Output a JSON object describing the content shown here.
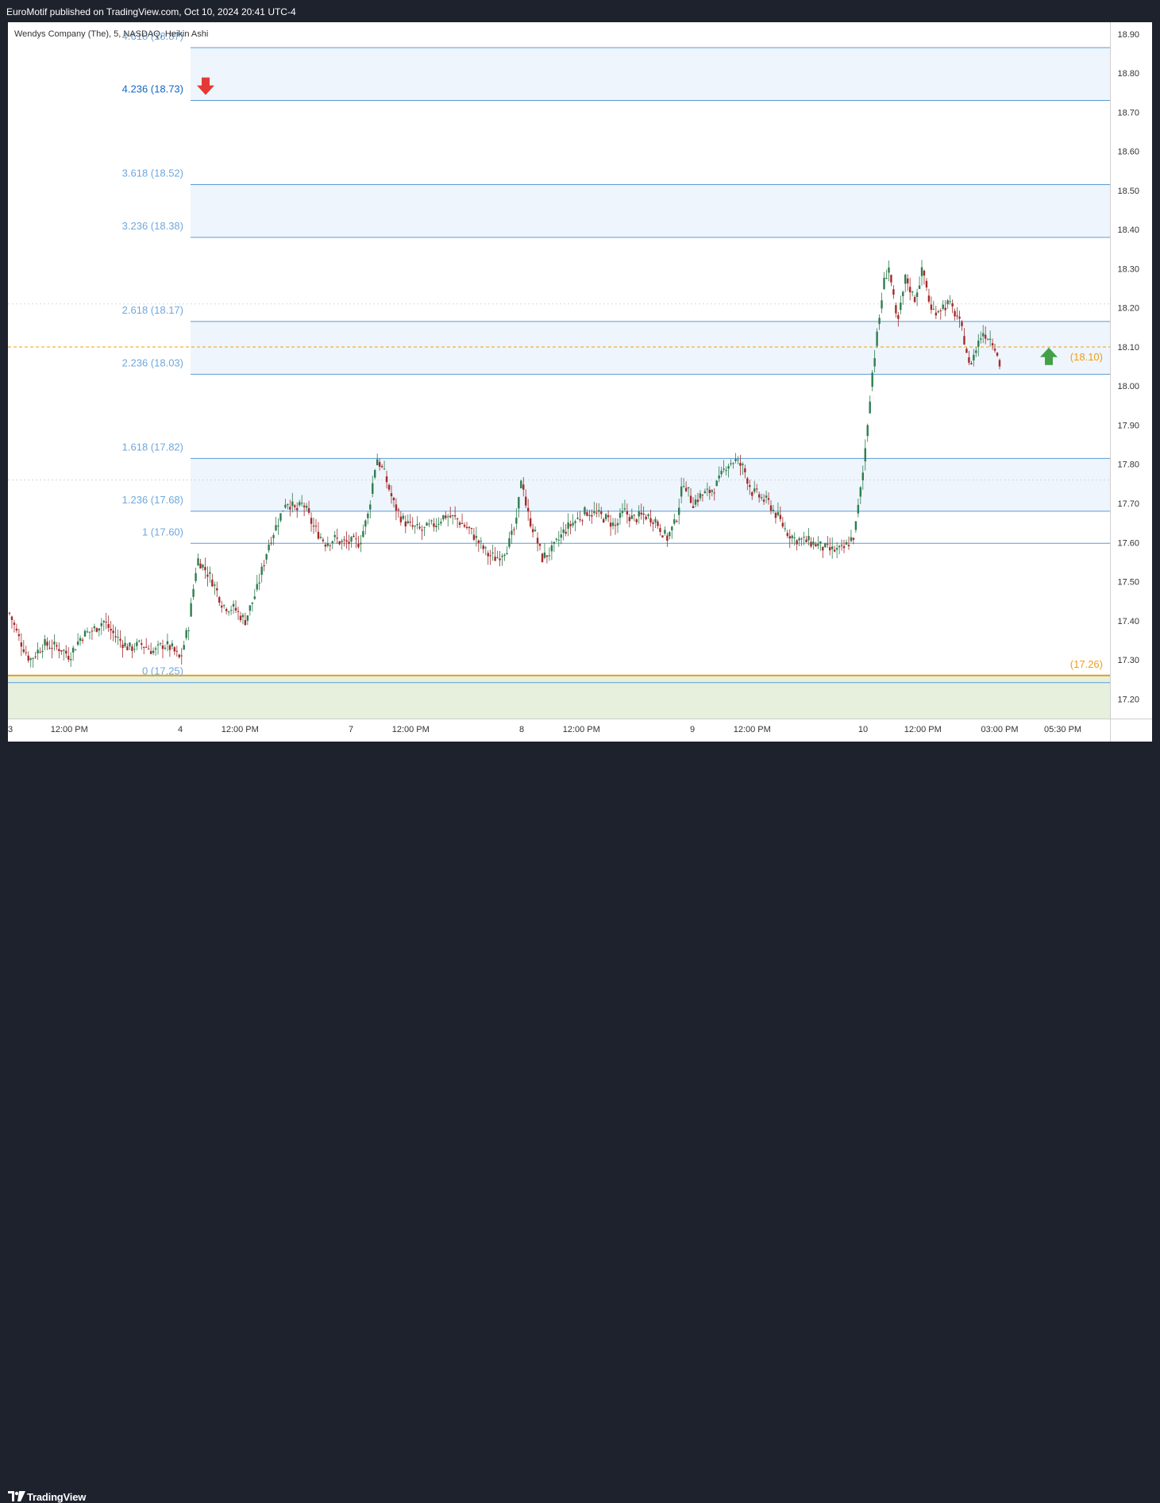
{
  "publisher": "EuroMotif published on TradingView.com, Oct 10, 2024 20:41 UTC-4",
  "symbol_legend": "Wendys Company (The), 5, NASDAQ, Heikin Ashi",
  "brand": "TradingView",
  "colors": {
    "up": "#2e7d4f",
    "down": "#a52a2a",
    "fib_line": "#5b9bd5",
    "fib_label": "#6fa8dc",
    "fib_label_emph": "#1565c0",
    "orange": "#f39c12",
    "zone_blue": "#eef5fc",
    "zone_green": "#e6f0dd",
    "arrow_down": "#e53935",
    "arrow_up": "#43a047"
  },
  "chart_data": {
    "type": "candlestick",
    "style": "Heikin Ashi",
    "interval": "5",
    "exchange": "NASDAQ",
    "y_axis": {
      "min": 17.15,
      "max": 18.93,
      "ticks": [
        "18.90",
        "18.80",
        "18.70",
        "18.60",
        "18.50",
        "18.40",
        "18.30",
        "18.20",
        "18.10",
        "18.00",
        "17.90",
        "17.80",
        "17.70",
        "17.60",
        "17.50",
        "17.40",
        "17.30",
        "17.20"
      ]
    },
    "x_axis": {
      "ticks": [
        {
          "label": "3",
          "t": 0.0
        },
        {
          "label": "12:00 PM",
          "t": 0.35
        },
        {
          "label": "4",
          "t": 1.0
        },
        {
          "label": "12:00 PM",
          "t": 1.35
        },
        {
          "label": "7",
          "t": 2.0
        },
        {
          "label": "12:00 PM",
          "t": 2.35
        },
        {
          "label": "8",
          "t": 3.0
        },
        {
          "label": "12:00 PM",
          "t": 3.35
        },
        {
          "label": "9",
          "t": 4.0
        },
        {
          "label": "12:00 PM",
          "t": 4.35
        },
        {
          "label": "10",
          "t": 5.0
        },
        {
          "label": "12:00 PM",
          "t": 5.35
        },
        {
          "label": "03:00 PM",
          "t": 5.8
        },
        {
          "label": "05:30 PM",
          "t": 6.17
        }
      ],
      "range": [
        0.0,
        6.4
      ]
    },
    "fib_levels": [
      {
        "ratio": "4.618",
        "price": "18.87",
        "label": "4.618 (18.87)",
        "value": 18.865
      },
      {
        "ratio": "4.236",
        "price": "18.73",
        "label": "4.236 (18.73)",
        "value": 18.73
      },
      {
        "ratio": "3.618",
        "price": "18.52",
        "label": "3.618 (18.52)",
        "value": 18.515
      },
      {
        "ratio": "3.236",
        "price": "18.38",
        "label": "3.236 (18.38)",
        "value": 18.38
      },
      {
        "ratio": "2.618",
        "price": "18.17",
        "label": "2.618 (18.17)",
        "value": 18.165
      },
      {
        "ratio": "2.236",
        "price": "18.03",
        "label": "2.236 (18.03)",
        "value": 18.03
      },
      {
        "ratio": "1.618",
        "price": "17.82",
        "label": "1.618 (17.82)",
        "value": 17.815
      },
      {
        "ratio": "1.236",
        "price": "17.68",
        "label": "1.236 (17.68)",
        "value": 17.68
      },
      {
        "ratio": "1",
        "price": "17.60",
        "label": "1 (17.60)",
        "value": 17.598
      },
      {
        "ratio": "0",
        "price": "17.25",
        "label": "0 (17.25)",
        "value": 17.25
      }
    ],
    "highlight_zones": [
      {
        "from": 18.73,
        "to": 18.865
      },
      {
        "from": 18.38,
        "to": 18.515
      },
      {
        "from": 18.03,
        "to": 18.165
      },
      {
        "from": 17.68,
        "to": 17.815
      }
    ],
    "current_price_line": 18.1,
    "current_price_label": "(18.10)",
    "support_line": 17.26,
    "support_label": "(17.26)",
    "dotted_lines": [
      18.21,
      17.76
    ],
    "annotations": [
      {
        "type": "arrow-down",
        "t": 1.12,
        "price": 18.74
      },
      {
        "type": "arrow-up",
        "t": 6.1,
        "price": 18.08
      }
    ],
    "price_path": [
      [
        0.0,
        17.42
      ],
      [
        0.05,
        17.36
      ],
      [
        0.12,
        17.3
      ],
      [
        0.2,
        17.34
      ],
      [
        0.3,
        17.33
      ],
      [
        0.35,
        17.31
      ],
      [
        0.42,
        17.36
      ],
      [
        0.5,
        17.38
      ],
      [
        0.55,
        17.4
      ],
      [
        0.62,
        17.36
      ],
      [
        0.7,
        17.33
      ],
      [
        0.78,
        17.34
      ],
      [
        0.85,
        17.32
      ],
      [
        0.9,
        17.34
      ],
      [
        0.95,
        17.33
      ],
      [
        1.0,
        17.3
      ],
      [
        1.05,
        17.39
      ],
      [
        1.1,
        17.56
      ],
      [
        1.18,
        17.51
      ],
      [
        1.25,
        17.44
      ],
      [
        1.32,
        17.43
      ],
      [
        1.38,
        17.4
      ],
      [
        1.45,
        17.48
      ],
      [
        1.52,
        17.6
      ],
      [
        1.58,
        17.66
      ],
      [
        1.62,
        17.71
      ],
      [
        1.68,
        17.68
      ],
      [
        1.72,
        17.7
      ],
      [
        1.78,
        17.64
      ],
      [
        1.85,
        17.6
      ],
      [
        1.9,
        17.61
      ],
      [
        1.95,
        17.6
      ],
      [
        2.05,
        17.6
      ],
      [
        2.1,
        17.67
      ],
      [
        2.15,
        17.82
      ],
      [
        2.2,
        17.77
      ],
      [
        2.25,
        17.7
      ],
      [
        2.3,
        17.66
      ],
      [
        2.35,
        17.64
      ],
      [
        2.42,
        17.63
      ],
      [
        2.5,
        17.65
      ],
      [
        2.55,
        17.67
      ],
      [
        2.62,
        17.66
      ],
      [
        2.7,
        17.63
      ],
      [
        2.75,
        17.6
      ],
      [
        2.8,
        17.57
      ],
      [
        2.85,
        17.56
      ],
      [
        2.92,
        17.59
      ],
      [
        2.97,
        17.65
      ],
      [
        3.0,
        17.78
      ],
      [
        3.03,
        17.68
      ],
      [
        3.08,
        17.62
      ],
      [
        3.12,
        17.56
      ],
      [
        3.18,
        17.58
      ],
      [
        3.25,
        17.63
      ],
      [
        3.3,
        17.65
      ],
      [
        3.38,
        17.68
      ],
      [
        3.45,
        17.67
      ],
      [
        3.5,
        17.66
      ],
      [
        3.55,
        17.64
      ],
      [
        3.6,
        17.68
      ],
      [
        3.65,
        17.66
      ],
      [
        3.72,
        17.67
      ],
      [
        3.78,
        17.66
      ],
      [
        3.85,
        17.61
      ],
      [
        3.9,
        17.65
      ],
      [
        3.95,
        17.76
      ],
      [
        4.0,
        17.7
      ],
      [
        4.05,
        17.72
      ],
      [
        4.1,
        17.73
      ],
      [
        4.15,
        17.75
      ],
      [
        4.2,
        17.8
      ],
      [
        4.25,
        17.81
      ],
      [
        4.3,
        17.79
      ],
      [
        4.35,
        17.73
      ],
      [
        4.45,
        17.7
      ],
      [
        4.55,
        17.63
      ],
      [
        4.6,
        17.61
      ],
      [
        4.7,
        17.6
      ],
      [
        4.8,
        17.58
      ],
      [
        4.88,
        17.58
      ],
      [
        4.95,
        17.62
      ],
      [
        5.0,
        17.78
      ],
      [
        5.05,
        18.02
      ],
      [
        5.08,
        18.12
      ],
      [
        5.12,
        18.26
      ],
      [
        5.15,
        18.31
      ],
      [
        5.2,
        18.15
      ],
      [
        5.25,
        18.28
      ],
      [
        5.3,
        18.22
      ],
      [
        5.35,
        18.3
      ],
      [
        5.4,
        18.19
      ],
      [
        5.45,
        18.2
      ],
      [
        5.5,
        18.21
      ],
      [
        5.55,
        18.18
      ],
      [
        5.6,
        18.11
      ],
      [
        5.62,
        18.05
      ],
      [
        5.65,
        18.08
      ],
      [
        5.7,
        18.14
      ],
      [
        5.75,
        18.12
      ],
      [
        5.78,
        18.1
      ],
      [
        5.8,
        18.05
      ]
    ]
  }
}
